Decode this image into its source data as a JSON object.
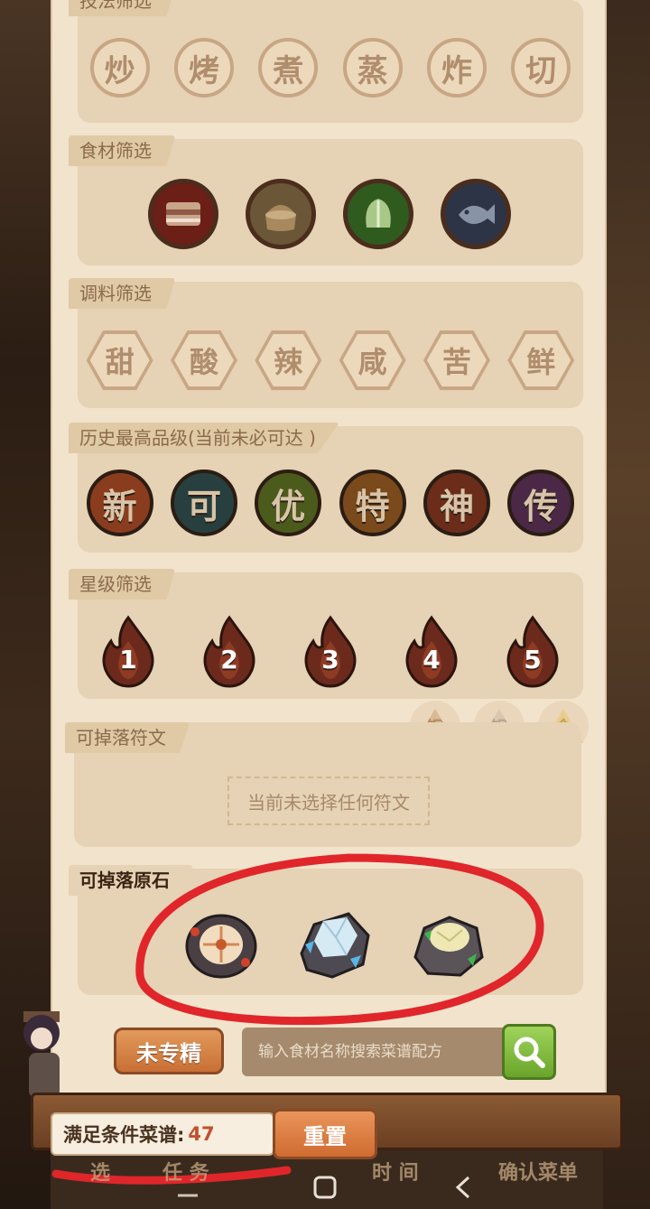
{
  "sections": {
    "technique": {
      "label": "技法筛选",
      "items": [
        "炒",
        "烤",
        "煮",
        "蒸",
        "炸",
        "切"
      ]
    },
    "ingredient": {
      "label": "食材筛选",
      "items": [
        {
          "icon": "meat-icon",
          "color": "#6b1f16"
        },
        {
          "icon": "grain-icon",
          "color": "#6b5637"
        },
        {
          "icon": "vegetable-icon",
          "color": "#2f5b1f"
        },
        {
          "icon": "fish-icon",
          "color": "#2d3446"
        }
      ]
    },
    "seasoning": {
      "label": "调料筛选",
      "items": [
        "甜",
        "酸",
        "辣",
        "咸",
        "苦",
        "鲜"
      ]
    },
    "grade": {
      "label": "历史最高品级(当前未必可达 )",
      "items": [
        {
          "text": "新",
          "color": "#8a3d1e"
        },
        {
          "text": "可",
          "color": "#27403f"
        },
        {
          "text": "优",
          "color": "#4b5b1c"
        },
        {
          "text": "特",
          "color": "#7a4a1c"
        },
        {
          "text": "神",
          "color": "#6b2d1a"
        },
        {
          "text": "传",
          "color": "#4a2846"
        }
      ]
    },
    "stars": {
      "label": "星级筛选",
      "items": [
        "1",
        "2",
        "3",
        "4",
        "5"
      ]
    },
    "rune": {
      "label": "可掉落符文",
      "empty_text": "当前未选择任何符文",
      "tiers": [
        "铜",
        "银",
        "金"
      ]
    },
    "stone": {
      "label": "可掉落原石",
      "items": [
        "fire-stone-icon",
        "ice-stone-icon",
        "nature-stone-icon"
      ]
    }
  },
  "controls": {
    "unspecialized_label": "未专精",
    "search_placeholder": "输入食材名称搜索菜谱配方",
    "count_label": "满足条件菜谱:",
    "count_value": "47",
    "reset_label": "重置",
    "confirm_label": "确认菜单",
    "under_tab_1": "选",
    "under_tab_2": "任 务",
    "under_tab_3": "时 间"
  },
  "colors": {
    "panel": "#f1e3cc",
    "section": "#e6d2b4",
    "accent_orange": "#cf6b31",
    "count_number": "#c0502f",
    "annotation_red": "#e0262b"
  }
}
